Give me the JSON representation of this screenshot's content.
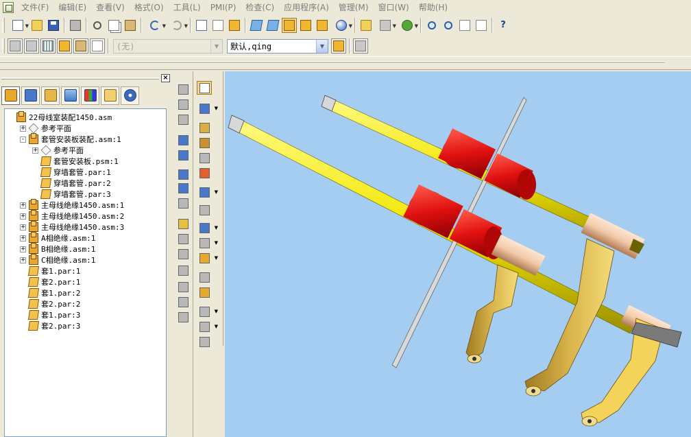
{
  "menu": {
    "items": [
      "文件(F)",
      "编辑(E)",
      "查看(V)",
      "格式(O)",
      "工具(L)",
      "PMI(P)",
      "检查(C)",
      "应用程序(A)",
      "管理(M)",
      "窗口(W)",
      "帮助(H)"
    ]
  },
  "toolbar2": {
    "style_combo": "(无)",
    "user_combo": "默认,qing"
  },
  "tree": {
    "items": [
      {
        "label": "22母线室装配1450.asm",
        "level": 0,
        "icon": "asm",
        "expander": ""
      },
      {
        "label": "参考平面",
        "level": 1,
        "icon": "plane",
        "expander": "+"
      },
      {
        "label": "套管安装板装配.asm:1",
        "level": 1,
        "icon": "asm",
        "expander": "-"
      },
      {
        "label": "参考平面",
        "level": 2,
        "icon": "plane",
        "expander": "+"
      },
      {
        "label": "套管安装板.psm:1",
        "level": 2,
        "icon": "par",
        "expander": ""
      },
      {
        "label": "穿墙套管.par:1",
        "level": 2,
        "icon": "par",
        "expander": ""
      },
      {
        "label": "穿墙套管.par:2",
        "level": 2,
        "icon": "par",
        "expander": ""
      },
      {
        "label": "穿墙套管.par:3",
        "level": 2,
        "icon": "par",
        "expander": ""
      },
      {
        "label": "主母线绝缘1450.asm:1",
        "level": 1,
        "icon": "asm",
        "expander": "+"
      },
      {
        "label": "主母线绝缘1450.asm:2",
        "level": 1,
        "icon": "asm",
        "expander": "+"
      },
      {
        "label": "主母线绝缘1450.asm:3",
        "level": 1,
        "icon": "asm",
        "expander": "+"
      },
      {
        "label": "A相绝缘.asm:1",
        "level": 1,
        "icon": "asm",
        "expander": "+"
      },
      {
        "label": "B相绝缘.asm:1",
        "level": 1,
        "icon": "asm",
        "expander": "+"
      },
      {
        "label": "C相绝缘.asm:1",
        "level": 1,
        "icon": "asm",
        "expander": "+"
      },
      {
        "label": "套1.par:1",
        "level": 1,
        "icon": "par",
        "expander": ""
      },
      {
        "label": "套2.par:1",
        "level": 1,
        "icon": "par",
        "expander": ""
      },
      {
        "label": "套1.par:2",
        "level": 1,
        "icon": "par",
        "expander": ""
      },
      {
        "label": "套2.par:2",
        "level": 1,
        "icon": "par",
        "expander": ""
      },
      {
        "label": "套1.par:3",
        "level": 1,
        "icon": "par",
        "expander": ""
      },
      {
        "label": "套2.par:3",
        "level": 1,
        "icon": "par",
        "expander": ""
      }
    ]
  },
  "colors": {
    "viewport_bg": "#a4cdf1",
    "busbar": "#f2e600",
    "bushing": "#e01010",
    "bracket": "#d9b44a",
    "sleeve": "#f2c9a8"
  },
  "pane_tabs": [
    "assembly-tree-icon",
    "layers-icon",
    "parts-library-icon",
    "features-icon",
    "sensors-icon",
    "properties-icon",
    "settings-icon"
  ]
}
